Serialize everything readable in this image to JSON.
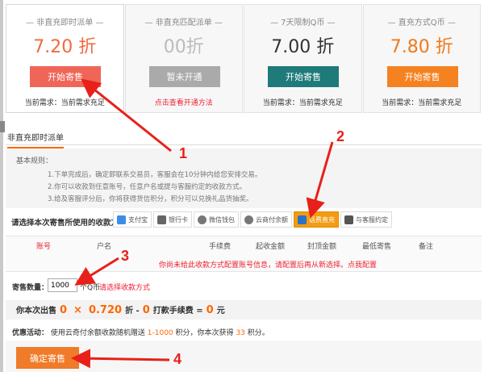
{
  "cards": [
    {
      "title": "— 非直充即时派单 —",
      "price": "7.20 折",
      "price_color": "#f26a3d",
      "button": "开始寄售",
      "button_color": "#ef6658",
      "note": "当前需求：当前需求充足"
    },
    {
      "title": "— 非直充匹配派单 —",
      "price": "00折",
      "price_color": "#bbbbbb",
      "button": "暂未开通",
      "button_color": "#aaaaaa",
      "note": "点击查看开通方法"
    },
    {
      "title": "— 7天限制Q币 —",
      "price": "7.00 折",
      "price_color": "#333333",
      "button": "开始寄售",
      "button_color": "#1f7a7a",
      "note": "当前需求：当前需求充足"
    },
    {
      "title": "— 直充方式Q币 —",
      "price": "7.80 折",
      "price_color": "#f07a1a",
      "button": "开始寄售",
      "button_color": "#f58220",
      "note": "当前需求：当前需求充足"
    }
  ],
  "tab": "非直充即时派单",
  "rules": {
    "title": "基本规则：",
    "items": [
      "1.下单完成后，确定即联系交易员，客服会在10分钟内给您安排交易。",
      "2.你可以收款到任意账号，任意户名或提与客服约定的收款方式。",
      "3.给及客服评分后，你将获得货信积分，积分可以兑换礼品货抽奖。"
    ]
  },
  "payment": {
    "label": "请选择本次寄售所使用的收款方式：",
    "options": [
      {
        "label": "支付宝",
        "icon": "alipay-icon",
        "color": "#3a8ee6"
      },
      {
        "label": "银行卡",
        "icon": "bank-card-icon",
        "color": "#666666"
      },
      {
        "label": "微信钱包",
        "icon": "wechat-icon",
        "color": "#777777"
      },
      {
        "label": "云商付余额",
        "icon": "cloud-pay-icon",
        "color": "#777777"
      },
      {
        "label": "话费直充",
        "icon": "phone-recharge-icon",
        "color": "#2a72c9",
        "selected": true
      },
      {
        "label": "与客服约定",
        "icon": "chat-icon",
        "color": "#555555"
      }
    ]
  },
  "table": {
    "headers": [
      "账号",
      "户名",
      "手续费",
      "起收金额",
      "封顶金额",
      "最低寄售",
      "备注"
    ],
    "message": "你尚未给此收款方式配置账号信息，请配置后再从新选择。点我配置"
  },
  "quantity": {
    "label": "寄售数量：",
    "value": "1000",
    "unit": "个Q币",
    "hint": "请选择收款方式"
  },
  "calc": {
    "prefix": "你本次出售",
    "qty": "0",
    "times": "×",
    "rate": "0.720",
    "rate_suffix": "折 -",
    "fee": "0",
    "fee_suffix": "打款手续费 =",
    "total": "0",
    "unit": "元"
  },
  "promo": {
    "label": "优惠活动：",
    "text1": "使用云奇付余额收款随机赠送",
    "range": "1-1000",
    "text2": "积分，你本次获得",
    "points": "33",
    "text3": "积分。"
  },
  "submit": "确定寄售",
  "annotations": [
    "1",
    "2",
    "3",
    "4"
  ]
}
